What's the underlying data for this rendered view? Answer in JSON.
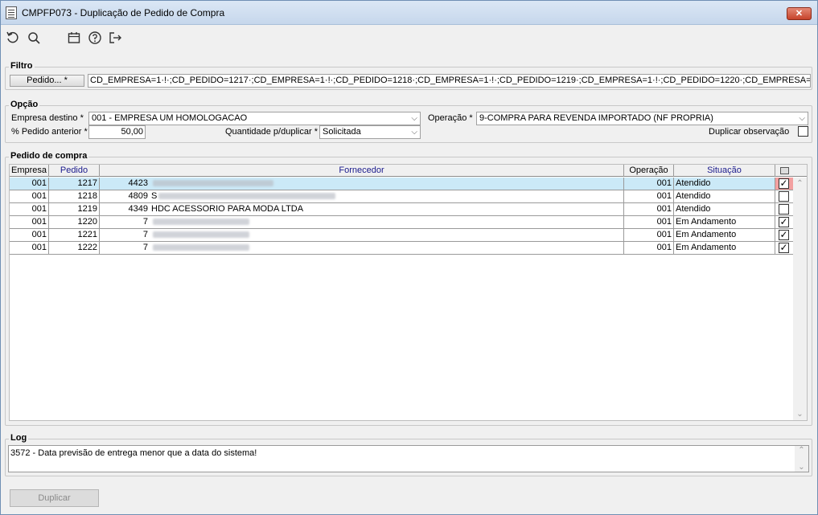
{
  "window": {
    "title": "CMPFP073 - Duplicação de Pedido de Compra",
    "close_label": "✕"
  },
  "toolbar": {
    "icons": [
      "refresh-icon",
      "search-icon",
      "calendar-icon",
      "help-icon",
      "exit-icon"
    ]
  },
  "filtro": {
    "title": "Filtro",
    "pedido_button": "Pedido... *",
    "value": "CD_EMPRESA=1·!·;CD_PEDIDO=1217·;CD_EMPRESA=1·!·;CD_PEDIDO=1218·;CD_EMPRESA=1·!·;CD_PEDIDO=1219·;CD_EMPRESA=1·!·;CD_PEDIDO=1220·;CD_EMPRESA=1·!·;CD_PEDIDO"
  },
  "opcao": {
    "title": "Opção",
    "empresa_destino_label": "Empresa destino *",
    "empresa_destino_value": "001 - EMPRESA UM HOMOLOGACAO",
    "operacao_label": "Operação *",
    "operacao_value": "9-COMPRA PARA REVENDA IMPORTADO (NF PROPRIA)",
    "pct_pedido_label": "% Pedido anterior *",
    "pct_pedido_value": "50,00",
    "quantidade_label": "Quantidade p/duplicar *",
    "quantidade_value": "Solicitada",
    "duplicar_obs_label": "Duplicar observação",
    "duplicar_obs_checked": false
  },
  "pedido": {
    "title": "Pedido de compra",
    "headers": {
      "empresa": "Empresa",
      "pedido": "Pedido",
      "fornecedor": "Fornecedor",
      "operacao": "Operação",
      "situacao": "Situação"
    },
    "rows": [
      {
        "empresa": "001",
        "pedido": "1217",
        "forn_code": "4423",
        "forn_name": "",
        "operacao": "001",
        "situacao": "Atendido",
        "checked": true,
        "selected": true
      },
      {
        "empresa": "001",
        "pedido": "1218",
        "forn_code": "4809",
        "forn_name": "S",
        "operacao": "001",
        "situacao": "Atendido",
        "checked": false,
        "selected": false
      },
      {
        "empresa": "001",
        "pedido": "1219",
        "forn_code": "4349",
        "forn_name": "HDC ACESSORIO PARA MODA LTDA",
        "operacao": "001",
        "situacao": "Atendido",
        "checked": false,
        "selected": false
      },
      {
        "empresa": "001",
        "pedido": "1220",
        "forn_code": "7",
        "forn_name": "",
        "operacao": "001",
        "situacao": "Em Andamento",
        "checked": true,
        "selected": false
      },
      {
        "empresa": "001",
        "pedido": "1221",
        "forn_code": "7",
        "forn_name": "",
        "operacao": "001",
        "situacao": "Em Andamento",
        "checked": true,
        "selected": false
      },
      {
        "empresa": "001",
        "pedido": "1222",
        "forn_code": "7",
        "forn_name": "",
        "operacao": "001",
        "situacao": "Em Andamento",
        "checked": true,
        "selected": false
      }
    ]
  },
  "log": {
    "title": "Log",
    "message": "3572 - Data previsão de entrega menor que a data do sistema!"
  },
  "footer": {
    "duplicar_label": "Duplicar"
  }
}
